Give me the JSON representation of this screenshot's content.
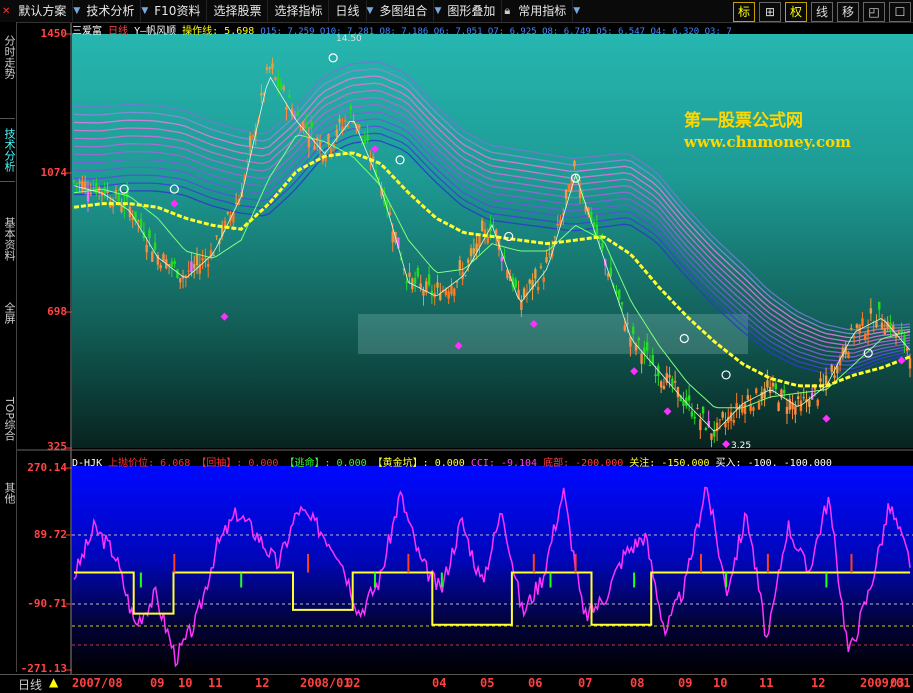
{
  "toolbar": {
    "items": [
      "默认方案",
      "技术分析",
      "F10资料",
      "选择股票",
      "选择指标",
      "日线",
      "多图组合",
      "图形叠加",
      "常用指标"
    ],
    "right_buttons": [
      "标",
      "⊞",
      "权",
      "线",
      "移",
      "◰",
      "☐"
    ]
  },
  "side_tabs": [
    "分时走势",
    "技术分析",
    "基本资料",
    "全屏",
    "TOP综合",
    "其他"
  ],
  "main_panel": {
    "stock": "三爱富",
    "period": "日线",
    "indicator_name": "Y—帆风顺",
    "operation_label": "操作线: 5.698",
    "ma_values": "Q15: 7.259  Q10: 7.281  Q8: 7.186  Q6: 7.051  Q7: 6.925  Q8: 6.749  Q5: 6.547  Q4: 6.320  Q3: 7",
    "y_ticks": [
      "1450",
      "1074",
      "698",
      "325"
    ],
    "high_label": "14.50",
    "low_label": "3.25"
  },
  "watermark": {
    "cn": "第一股票公式网",
    "url": "www.chnmoney.com"
  },
  "sub_panel": {
    "indicator": "D-HJK",
    "legend": [
      {
        "text": "上抛价位: 6.068",
        "color": "#ff3030"
      },
      {
        "text": "【回抽】: 0.000",
        "color": "#ff3030"
      },
      {
        "text": "【逃命】: 0.000",
        "color": "#30ff30"
      },
      {
        "text": "【黄金坑】: 0.000",
        "color": "#ffff40"
      },
      {
        "text": "CCI: -9.104",
        "color": "#ff40ff"
      },
      {
        "text": "底部: -200.000",
        "color": "#ff4040"
      },
      {
        "text": "关注: -150.000",
        "color": "#ffff40"
      },
      {
        "text": "买入: -100.",
        "color": "#ffffff"
      },
      {
        "text": "-100.000",
        "color": "#ffffff"
      }
    ],
    "y_ticks": [
      "270.14",
      "89.72",
      "-90.71",
      "-271.13"
    ]
  },
  "bottom": {
    "period_label": "日线",
    "date_ticks": [
      "2007/08",
      "09",
      "10",
      "11",
      "12",
      "2008/01",
      "02",
      "04",
      "05",
      "06",
      "07",
      "08",
      "09",
      "10",
      "11",
      "12",
      "2009/01",
      "03"
    ]
  },
  "chart_data": [
    {
      "type": "line",
      "ylim": [
        3.25,
        14.5
      ],
      "y_tick_labels": [
        "1450",
        "1074",
        "698",
        "325"
      ],
      "series": [
        {
          "values": [
            10.5,
            10.3,
            9.8,
            8.5,
            7.9,
            8.6,
            10.2,
            13.6,
            12.3,
            11.4,
            12.4,
            10.5,
            7.8,
            7.4,
            8.0,
            9.4,
            7.2,
            8.2,
            10.8,
            8.5,
            6.2,
            5.3,
            4.4,
            3.6,
            4.4,
            4.8,
            4.3,
            4.9,
            6.4,
            6.8,
            5.9
          ]
        },
        {
          "values": [
            10.2,
            10.3,
            10.1,
            9.5,
            8.6,
            8.4,
            8.9,
            10.6,
            11.8,
            11.6,
            11.2,
            10.4,
            8.9,
            8.0,
            8.1,
            8.8,
            8.6,
            8.6,
            9.3,
            8.9,
            7.2,
            6.0,
            5.0,
            4.3,
            4.3,
            4.6,
            4.7,
            4.8,
            5.5,
            6.2,
            6.4
          ]
        },
        {
          "values": [
            9.8,
            9.9,
            9.9,
            9.8,
            9.5,
            9.3,
            9.2,
            9.9,
            10.8,
            11.2,
            11.3,
            11.0,
            10.2,
            9.5,
            9.1,
            9.0,
            8.9,
            8.8,
            8.9,
            9.0,
            8.5,
            7.6,
            6.8,
            6.1,
            5.5,
            5.1,
            4.9,
            4.9,
            5.2,
            5.4,
            5.7
          ]
        }
      ]
    },
    {
      "type": "line",
      "ylim": [
        -271.13,
        270.14
      ],
      "y_tick_labels": [
        "270.14",
        "89.72",
        "-90.71",
        "-271.13"
      ],
      "series": [
        {
          "values": [
            -20,
            110,
            40,
            -150,
            -70,
            -240,
            -140,
            60,
            150,
            90,
            10,
            160,
            110,
            40,
            -120,
            -30,
            200,
            20,
            -60,
            130,
            -40,
            160,
            -120,
            -20,
            210,
            -130,
            -80,
            40,
            90,
            -170,
            -40,
            230,
            -60,
            150,
            -200,
            120,
            -10,
            190,
            -230,
            -60,
            170,
            20
          ]
        },
        {
          "values": [
            -10,
            -10,
            -10,
            -120,
            -120,
            -10,
            -10,
            -10,
            -10,
            -10,
            -10,
            -110,
            -110,
            -110,
            -10,
            -10,
            -10,
            -10,
            -150,
            -150,
            -150,
            -150,
            -10,
            -10,
            -10,
            -10,
            -150,
            -150,
            -150,
            -10,
            -10,
            -10,
            -10,
            -10,
            -10,
            -10,
            -10,
            -10,
            -10,
            -10,
            -10,
            -10
          ]
        }
      ]
    }
  ]
}
